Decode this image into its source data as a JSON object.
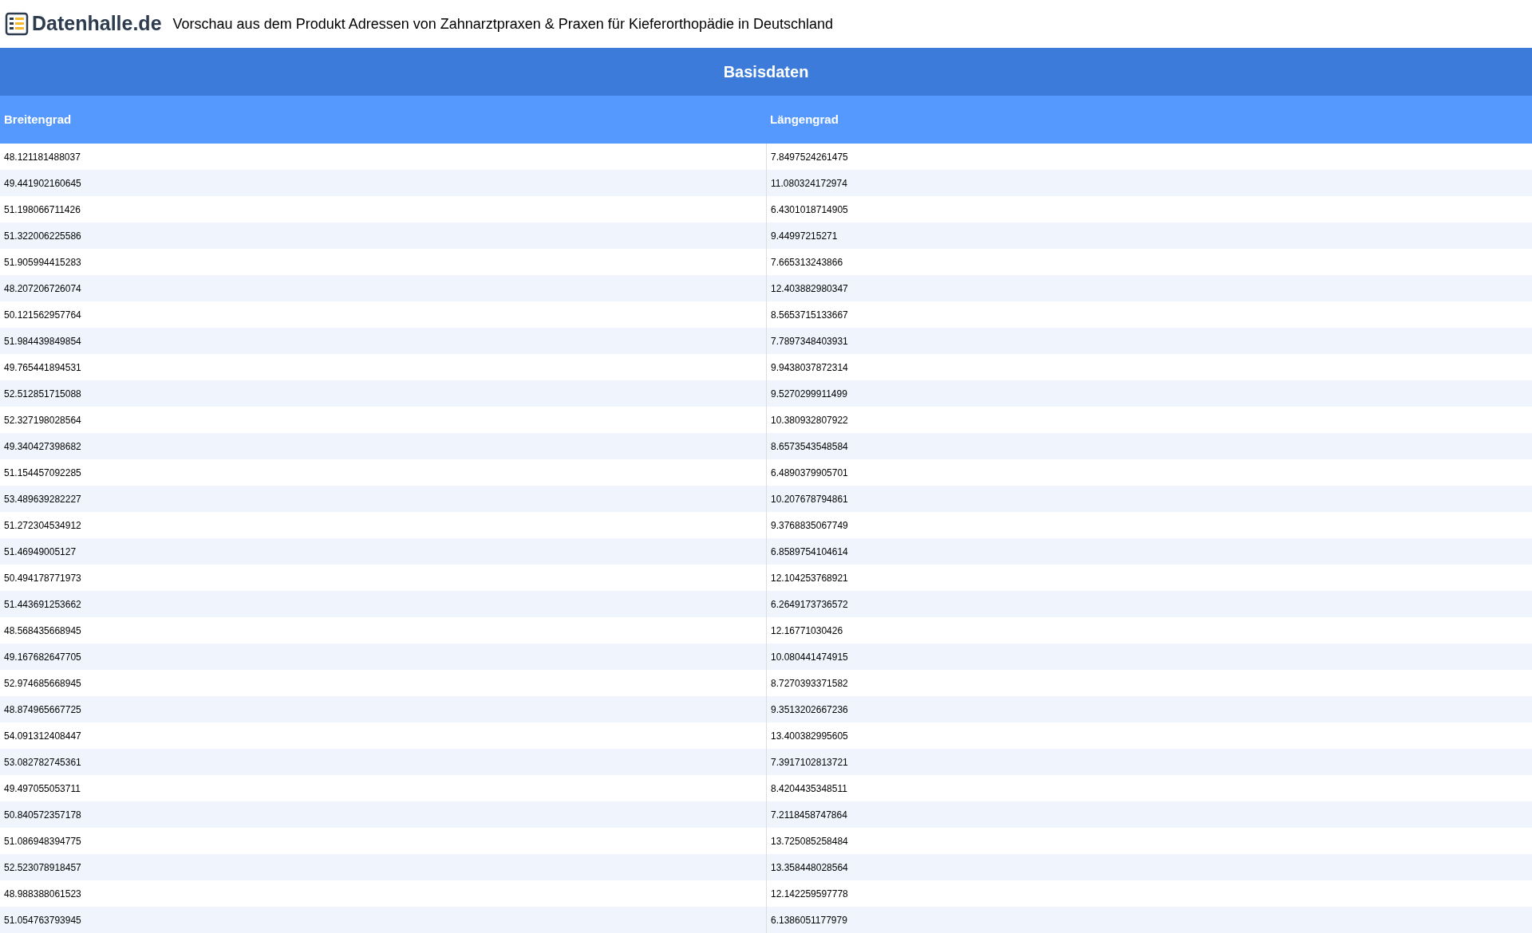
{
  "header": {
    "logo": "Datenhalle.de",
    "title": "Vorschau aus dem Produkt Adressen von Zahnarztpraxen & Praxen für Kieferorthopädie in Deutschland"
  },
  "table": {
    "caption": "Basisdaten",
    "columns": [
      "Breitengrad",
      "Längengrad"
    ],
    "rows": [
      [
        "48.121181488037",
        "7.8497524261475"
      ],
      [
        "49.441902160645",
        "11.080324172974"
      ],
      [
        "51.198066711426",
        "6.4301018714905"
      ],
      [
        "51.322006225586",
        "9.44997215271"
      ],
      [
        "51.905994415283",
        "7.665313243866"
      ],
      [
        "48.207206726074",
        "12.403882980347"
      ],
      [
        "50.121562957764",
        "8.5653715133667"
      ],
      [
        "51.984439849854",
        "7.7897348403931"
      ],
      [
        "49.765441894531",
        "9.9438037872314"
      ],
      [
        "52.512851715088",
        "9.5270299911499"
      ],
      [
        "52.327198028564",
        "10.380932807922"
      ],
      [
        "49.340427398682",
        "8.6573543548584"
      ],
      [
        "51.154457092285",
        "6.4890379905701"
      ],
      [
        "53.489639282227",
        "10.207678794861"
      ],
      [
        "51.272304534912",
        "9.3768835067749"
      ],
      [
        "51.46949005127",
        "6.8589754104614"
      ],
      [
        "50.494178771973",
        "12.104253768921"
      ],
      [
        "51.443691253662",
        "6.2649173736572"
      ],
      [
        "48.568435668945",
        "12.16771030426"
      ],
      [
        "49.167682647705",
        "10.080441474915"
      ],
      [
        "52.974685668945",
        "8.7270393371582"
      ],
      [
        "48.874965667725",
        "9.3513202667236"
      ],
      [
        "54.091312408447",
        "13.400382995605"
      ],
      [
        "53.082782745361",
        "7.3917102813721"
      ],
      [
        "49.497055053711",
        "8.4204435348511"
      ],
      [
        "50.840572357178",
        "7.2118458747864"
      ],
      [
        "51.086948394775",
        "13.725085258484"
      ],
      [
        "52.523078918457",
        "13.358448028564"
      ],
      [
        "48.988388061523",
        "12.142259597778"
      ],
      [
        "51.054763793945",
        "6.1386051177979"
      ]
    ]
  }
}
